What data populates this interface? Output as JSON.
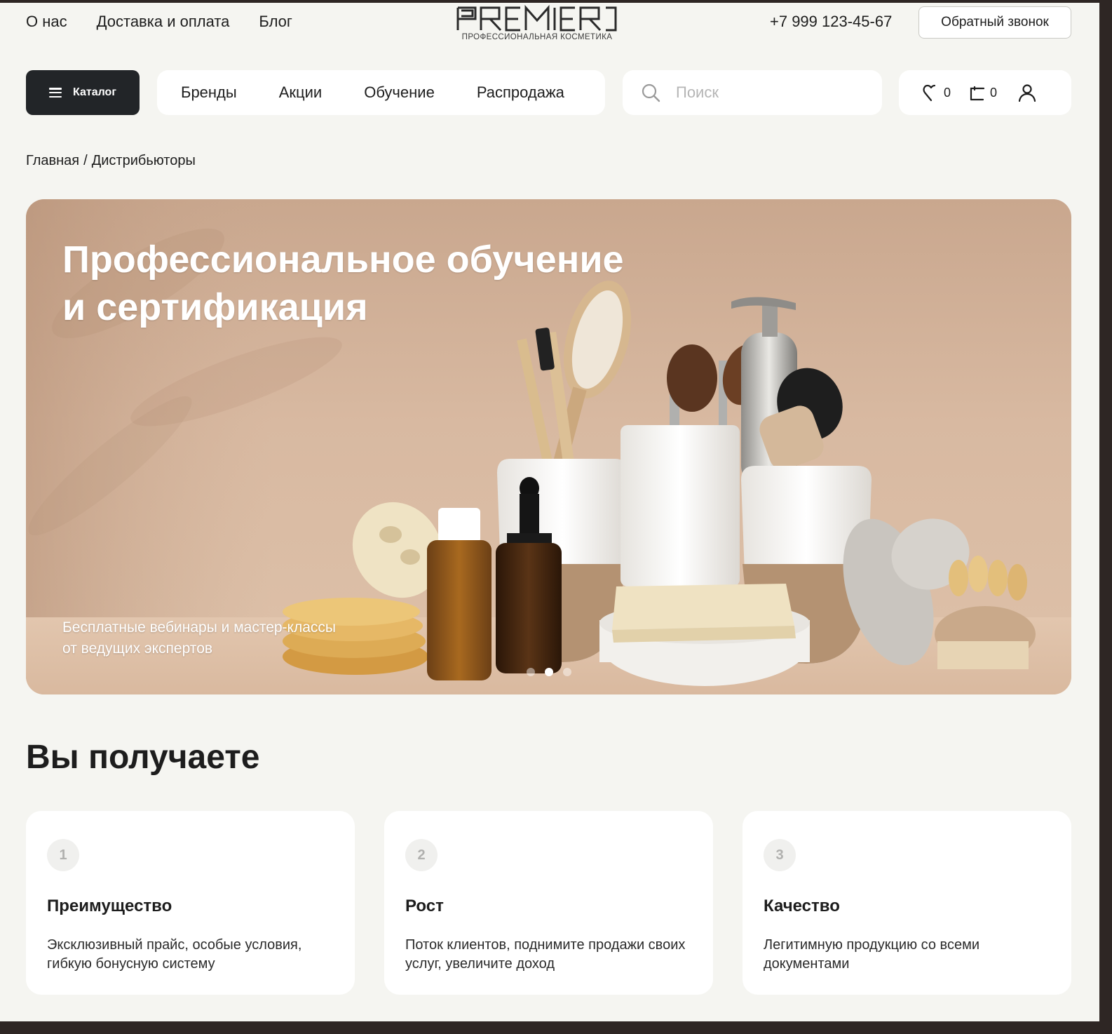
{
  "header": {
    "top_links": [
      "О нас",
      "Доставка и оплата",
      "Блог"
    ],
    "logo_text": "PREMIER",
    "logo_subtitle": "профессиональная косметика",
    "phone": "+7 999 123-45-67",
    "callback_label": "Обратный звонок"
  },
  "nav": {
    "catalog_label": "Каталог",
    "items": [
      "Бренды",
      "Акции",
      "Обучение",
      "Распродажа"
    ],
    "search_placeholder": "Поиск",
    "favorites_count": "0",
    "cart_count": "0"
  },
  "breadcrumb": {
    "home": "Главная",
    "separator": "/",
    "current": "Дистрибьюторы"
  },
  "hero": {
    "title_line1": "Профессиональное обучение",
    "title_line2": "и сертификация",
    "subtitle_line1": "Бесплатные вебинары и мастер-классы",
    "subtitle_line2": "от ведущих экспертов",
    "slides_total": 3,
    "active_slide": 2
  },
  "benefits": {
    "title": "Вы получаете",
    "cards": [
      {
        "num": "1",
        "title": "Преимущество",
        "text": "Эксклюзивный прайс, особые условия, гибкую бонусную систему"
      },
      {
        "num": "2",
        "title": "Рост",
        "text": "Поток клиентов, поднимите продажи своих услуг, увеличите доход"
      },
      {
        "num": "3",
        "title": "Качество",
        "text": "Легитимную продукцию со всеми документами"
      }
    ]
  },
  "colors": {
    "page_bg": "#f5f5f1",
    "dark_button": "#222528",
    "hero_bg": "#d8b9a1"
  }
}
